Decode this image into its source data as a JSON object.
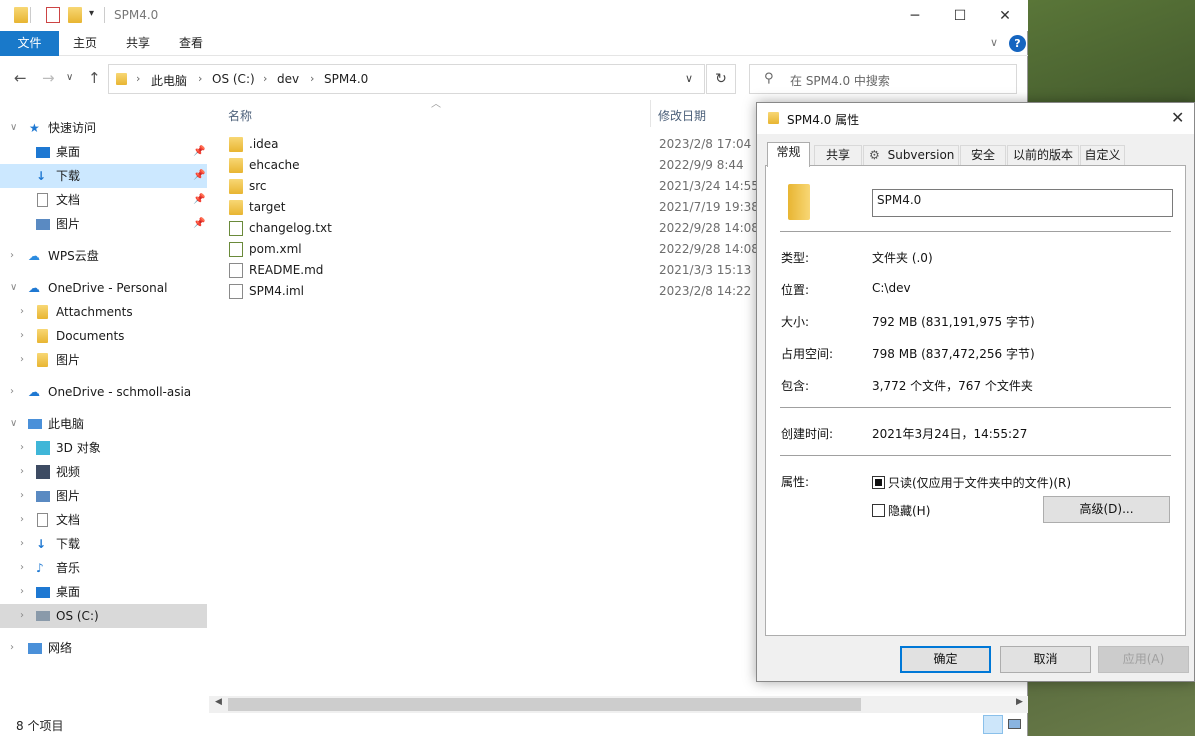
{
  "explorer": {
    "title": "SPM4.0",
    "ribbon_tabs": [
      "文件",
      "主页",
      "共享",
      "查看"
    ],
    "address": {
      "crumbs": [
        "此电脑",
        "OS (C:)",
        "dev",
        "SPM4.0"
      ]
    },
    "search_placeholder": "在 SPM4.0 中搜索",
    "columns": {
      "name": "名称",
      "modified": "修改日期"
    },
    "files": [
      {
        "name": ".idea",
        "date": "2023/2/8 17:04",
        "type": "folder"
      },
      {
        "name": "ehcache",
        "date": "2022/9/9 8:44",
        "type": "folder"
      },
      {
        "name": "src",
        "date": "2021/3/24 14:55",
        "type": "folder"
      },
      {
        "name": "target",
        "date": "2021/7/19 19:38",
        "type": "folder"
      },
      {
        "name": "changelog.txt",
        "date": "2022/9/28 14:08",
        "type": "txt"
      },
      {
        "name": "pom.xml",
        "date": "2022/9/28 14:08",
        "type": "txt"
      },
      {
        "name": "README.md",
        "date": "2021/3/3 15:13",
        "type": "doc"
      },
      {
        "name": "SPM4.iml",
        "date": "2023/2/8 14:22",
        "type": "doc"
      }
    ],
    "status_count": "8 个项目"
  },
  "sidebar": {
    "quick_access": "快速访问",
    "quick_items": [
      "桌面",
      "下载",
      "文档",
      "图片"
    ],
    "wps": "WPS云盘",
    "onedrive_personal": "OneDrive - Personal",
    "onedrive_items": [
      "Attachments",
      "Documents",
      "图片"
    ],
    "onedrive_asia": "OneDrive - schmoll-asia",
    "this_pc": "此电脑",
    "pc_items": [
      "3D 对象",
      "视频",
      "图片",
      "文档",
      "下载",
      "音乐",
      "桌面",
      "OS (C:)"
    ],
    "network": "网络"
  },
  "dialog": {
    "title": "SPM4.0 属性",
    "tabs": [
      "常规",
      "共享",
      "Subversion",
      "安全",
      "以前的版本",
      "自定义"
    ],
    "name_value": "SPM4.0",
    "props": {
      "type_label": "类型:",
      "type_value": "文件夹 (.0)",
      "location_label": "位置:",
      "location_value": "C:\\dev",
      "size_label": "大小:",
      "size_value": "792 MB (831,191,975 字节)",
      "disk_label": "占用空间:",
      "disk_value": "798 MB (837,472,256 字节)",
      "contains_label": "包含:",
      "contains_value": "3,772 个文件，767 个文件夹",
      "created_label": "创建时间:",
      "created_value": "2021年3月24日，14:55:27",
      "attrs_label": "属性:"
    },
    "readonly_label": "只读(仅应用于文件夹中的文件)(R)",
    "hidden_label": "隐藏(H)",
    "advanced_btn": "高级(D)...",
    "ok_btn": "确定",
    "cancel_btn": "取消",
    "apply_btn": "应用(A)"
  }
}
